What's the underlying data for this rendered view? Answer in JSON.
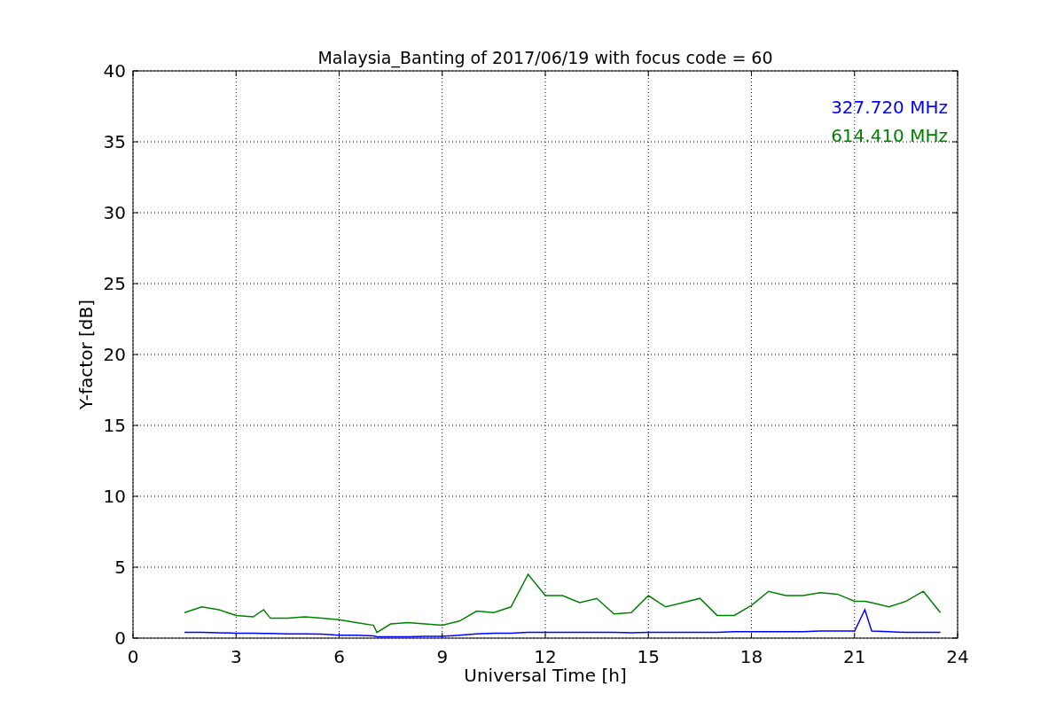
{
  "figure": {
    "chart_data": {
      "type": "line",
      "title": "Malaysia_Banting of 2017/06/19 with focus code = 60",
      "xlabel": "Universal Time [h]",
      "ylabel": "Y-factor [dB]",
      "x": [
        1.5,
        2,
        2.5,
        3,
        3.5,
        3.8,
        4,
        4.5,
        5,
        5.5,
        6,
        6.5,
        7,
        7.1,
        7.5,
        8,
        8.5,
        9,
        9.5,
        10,
        10.5,
        11,
        11.5,
        12,
        12.5,
        13,
        13.5,
        14,
        14.5,
        15,
        15.5,
        16,
        16.5,
        17,
        17.5,
        18,
        18.5,
        19,
        19.5,
        20,
        20.5,
        21,
        21.3,
        21.5,
        22,
        22.5,
        23,
        23.5
      ],
      "series": [
        {
          "name": "327.720 MHz",
          "color": "#0000ff",
          "values": [
            0.4,
            0.4,
            0.38,
            0.35,
            0.35,
            0.33,
            0.33,
            0.3,
            0.3,
            0.28,
            0.2,
            0.2,
            0.15,
            0.1,
            0.1,
            0.1,
            0.12,
            0.12,
            0.2,
            0.3,
            0.35,
            0.35,
            0.4,
            0.4,
            0.4,
            0.4,
            0.4,
            0.4,
            0.38,
            0.4,
            0.4,
            0.4,
            0.4,
            0.4,
            0.45,
            0.45,
            0.45,
            0.45,
            0.45,
            0.5,
            0.5,
            0.5,
            2.0,
            0.5,
            0.45,
            0.4,
            0.4,
            0.4
          ]
        },
        {
          "name": "614.410 MHz",
          "color": "#008000",
          "values": [
            1.8,
            2.2,
            2.0,
            1.6,
            1.5,
            2.0,
            1.4,
            1.4,
            1.5,
            1.4,
            1.3,
            1.1,
            0.9,
            0.4,
            1.0,
            1.1,
            1.0,
            0.9,
            1.2,
            1.9,
            1.8,
            2.2,
            4.5,
            3.0,
            3.0,
            2.5,
            2.8,
            1.7,
            1.8,
            3.0,
            2.2,
            2.5,
            2.8,
            1.6,
            1.6,
            2.3,
            3.3,
            3.0,
            3.0,
            3.2,
            3.1,
            2.6,
            2.6,
            2.5,
            2.2,
            2.6,
            3.3,
            1.8
          ]
        }
      ],
      "xlim": [
        0,
        24
      ],
      "ylim": [
        0,
        40
      ],
      "xticks": [
        0,
        3,
        6,
        9,
        12,
        15,
        18,
        21,
        24
      ],
      "yticks": [
        0,
        5,
        10,
        15,
        20,
        25,
        30,
        35,
        40
      ],
      "grid": true
    }
  }
}
